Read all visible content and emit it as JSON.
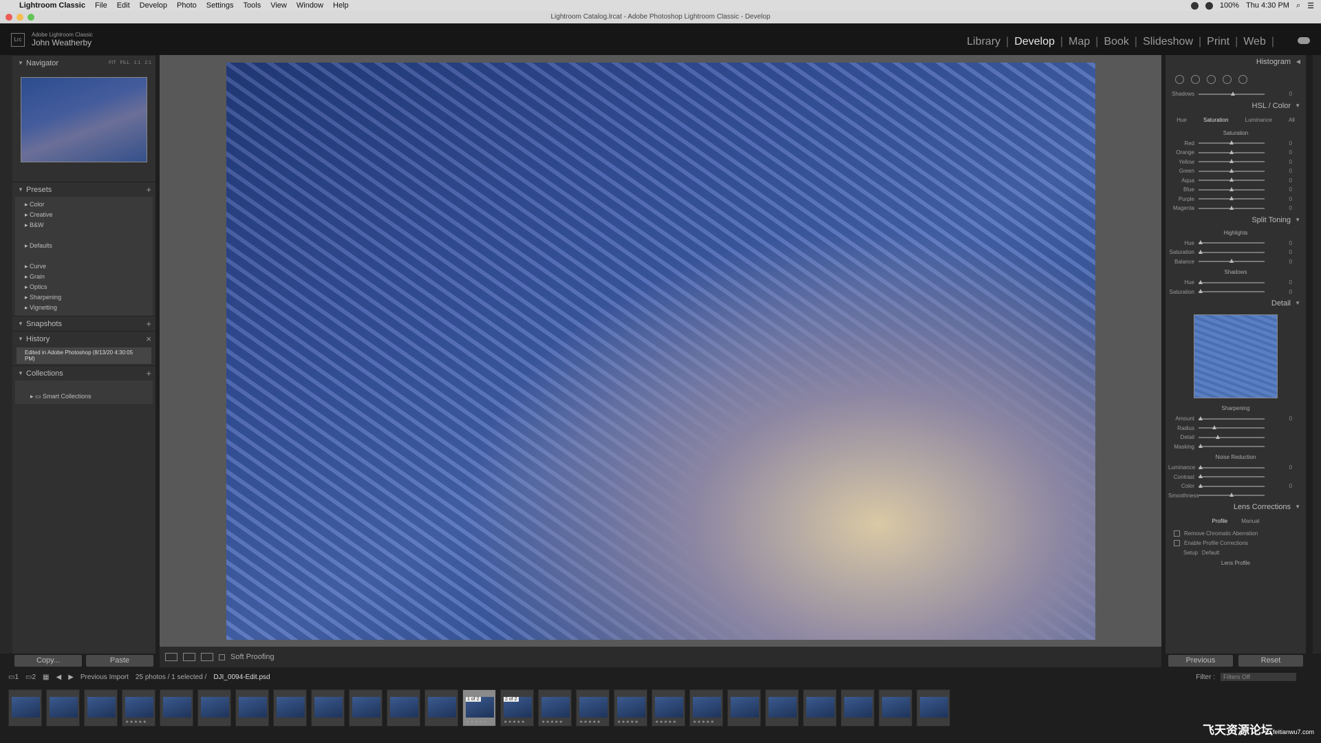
{
  "menubar": {
    "app": "Lightroom Classic",
    "items": [
      "File",
      "Edit",
      "Develop",
      "Photo",
      "Settings",
      "Tools",
      "View",
      "Window",
      "Help"
    ],
    "battery": "100%",
    "clock": "Thu 4:30 PM"
  },
  "window": {
    "title": "Lightroom Catalog.lrcat - Adobe Photoshop Lightroom Classic - Develop"
  },
  "identity": {
    "logo": "Lrc",
    "product": "Adobe Lightroom Classic",
    "user": "John Weatherby"
  },
  "modules": [
    "Library",
    "Develop",
    "Map",
    "Book",
    "Slideshow",
    "Print",
    "Web"
  ],
  "active_module": "Develop",
  "left": {
    "navigator": {
      "title": "Navigator",
      "zoom": [
        "FIT",
        "FILL",
        "1:1",
        "2:1"
      ]
    },
    "presets": {
      "title": "Presets",
      "groups1": [
        "Color",
        "Creative",
        "B&W"
      ],
      "groups2": [
        "Defaults"
      ],
      "groups3": [
        "Curve",
        "Grain",
        "Optics",
        "Sharpening",
        "Vignetting"
      ]
    },
    "snapshots": {
      "title": "Snapshots"
    },
    "history": {
      "title": "History",
      "entry": "Edited in Adobe Photoshop (8/13/20 4:30:05 PM)"
    },
    "collections": {
      "title": "Collections",
      "item": "Smart Collections"
    },
    "copy": "Copy...",
    "paste": "Paste"
  },
  "toolbar": {
    "soft_proofing": "Soft Proofing"
  },
  "right": {
    "histogram": "Histogram",
    "shadows": {
      "label": "Shadows",
      "value": "0"
    },
    "hsl": {
      "title": "HSL / Color",
      "tabs": [
        "Hue",
        "Saturation",
        "Luminance",
        "All"
      ],
      "sub": "Saturation",
      "rows": [
        {
          "l": "Red",
          "v": "0"
        },
        {
          "l": "Orange",
          "v": "0"
        },
        {
          "l": "Yellow",
          "v": "0"
        },
        {
          "l": "Green",
          "v": "0"
        },
        {
          "l": "Aqua",
          "v": "0"
        },
        {
          "l": "Blue",
          "v": "0"
        },
        {
          "l": "Purple",
          "v": "0"
        },
        {
          "l": "Magenta",
          "v": "0"
        }
      ]
    },
    "split": {
      "title": "Split Toning",
      "highlights": "Highlights",
      "hue": "Hue",
      "sat": "Saturation",
      "balance": "Balance",
      "shadows": "Shadows",
      "v": "0"
    },
    "detail": {
      "title": "Detail",
      "sharpening": "Sharpening",
      "amount": "Amount",
      "radius": "Radius",
      "detail": "Detail",
      "masking": "Masking",
      "noise": "Noise Reduction",
      "luminance": "Luminance",
      "contrast": "Contrast",
      "color": "Color",
      "smoothness": "Smoothness",
      "v": "0"
    },
    "lens": {
      "title": "Lens Corrections",
      "tabs": [
        "Profile",
        "Manual"
      ],
      "cb1": "Remove Chromatic Aberration",
      "cb2": "Enable Profile Corrections",
      "setup": "Setup",
      "default": "Default",
      "lens_profile": "Lens Profile"
    },
    "previous": "Previous",
    "reset": "Reset"
  },
  "filmbar": {
    "import": "Previous Import",
    "count": "25 photos / 1 selected /",
    "file": "DJI_0094-Edit.psd",
    "filter_label": "Filter :",
    "filter_value": "Filters Off"
  },
  "filmstrip": {
    "badges": [
      "1 of 2",
      "2 of 2"
    ]
  },
  "watermark": {
    "text": "飞天资源论坛",
    "sub": "feitianwu7.com"
  }
}
